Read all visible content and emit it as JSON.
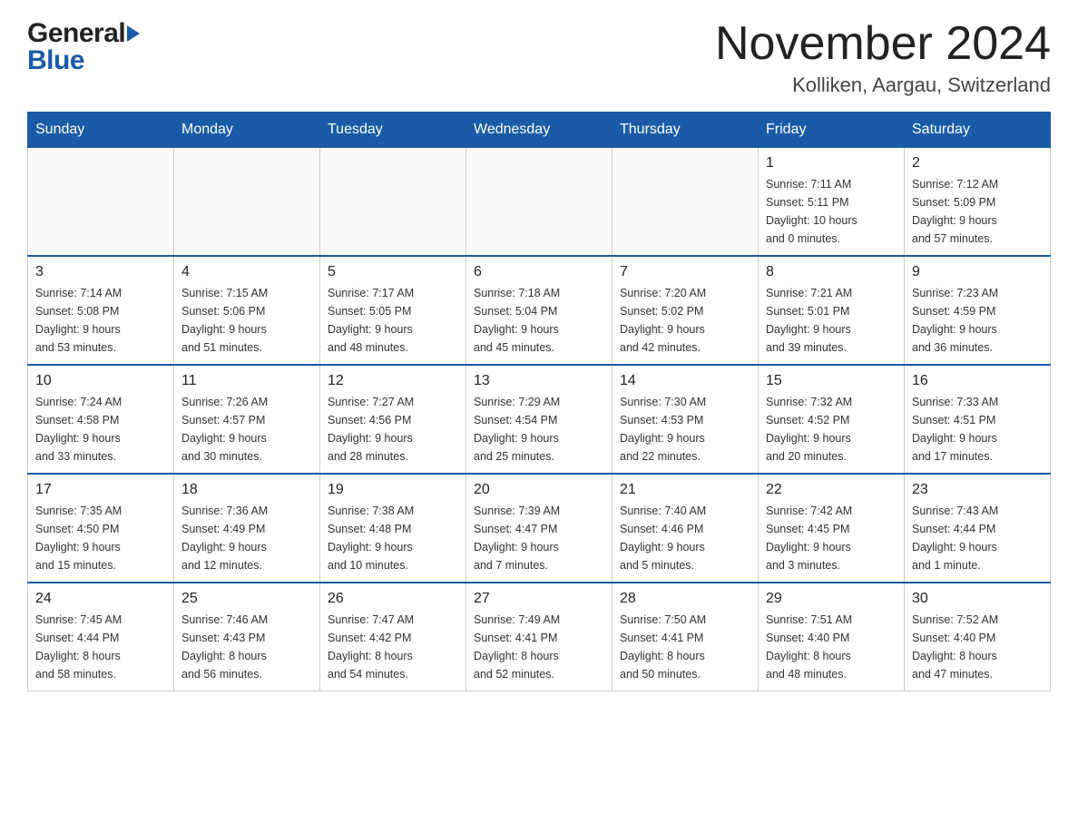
{
  "header": {
    "logo_general": "General",
    "logo_blue": "Blue",
    "title": "November 2024",
    "subtitle": "Kolliken, Aargau, Switzerland"
  },
  "days_of_week": [
    "Sunday",
    "Monday",
    "Tuesday",
    "Wednesday",
    "Thursday",
    "Friday",
    "Saturday"
  ],
  "weeks": [
    {
      "days": [
        {
          "date": "",
          "info": ""
        },
        {
          "date": "",
          "info": ""
        },
        {
          "date": "",
          "info": ""
        },
        {
          "date": "",
          "info": ""
        },
        {
          "date": "",
          "info": ""
        },
        {
          "date": "1",
          "info": "Sunrise: 7:11 AM\nSunset: 5:11 PM\nDaylight: 10 hours\nand 0 minutes."
        },
        {
          "date": "2",
          "info": "Sunrise: 7:12 AM\nSunset: 5:09 PM\nDaylight: 9 hours\nand 57 minutes."
        }
      ]
    },
    {
      "days": [
        {
          "date": "3",
          "info": "Sunrise: 7:14 AM\nSunset: 5:08 PM\nDaylight: 9 hours\nand 53 minutes."
        },
        {
          "date": "4",
          "info": "Sunrise: 7:15 AM\nSunset: 5:06 PM\nDaylight: 9 hours\nand 51 minutes."
        },
        {
          "date": "5",
          "info": "Sunrise: 7:17 AM\nSunset: 5:05 PM\nDaylight: 9 hours\nand 48 minutes."
        },
        {
          "date": "6",
          "info": "Sunrise: 7:18 AM\nSunset: 5:04 PM\nDaylight: 9 hours\nand 45 minutes."
        },
        {
          "date": "7",
          "info": "Sunrise: 7:20 AM\nSunset: 5:02 PM\nDaylight: 9 hours\nand 42 minutes."
        },
        {
          "date": "8",
          "info": "Sunrise: 7:21 AM\nSunset: 5:01 PM\nDaylight: 9 hours\nand 39 minutes."
        },
        {
          "date": "9",
          "info": "Sunrise: 7:23 AM\nSunset: 4:59 PM\nDaylight: 9 hours\nand 36 minutes."
        }
      ]
    },
    {
      "days": [
        {
          "date": "10",
          "info": "Sunrise: 7:24 AM\nSunset: 4:58 PM\nDaylight: 9 hours\nand 33 minutes."
        },
        {
          "date": "11",
          "info": "Sunrise: 7:26 AM\nSunset: 4:57 PM\nDaylight: 9 hours\nand 30 minutes."
        },
        {
          "date": "12",
          "info": "Sunrise: 7:27 AM\nSunset: 4:56 PM\nDaylight: 9 hours\nand 28 minutes."
        },
        {
          "date": "13",
          "info": "Sunrise: 7:29 AM\nSunset: 4:54 PM\nDaylight: 9 hours\nand 25 minutes."
        },
        {
          "date": "14",
          "info": "Sunrise: 7:30 AM\nSunset: 4:53 PM\nDaylight: 9 hours\nand 22 minutes."
        },
        {
          "date": "15",
          "info": "Sunrise: 7:32 AM\nSunset: 4:52 PM\nDaylight: 9 hours\nand 20 minutes."
        },
        {
          "date": "16",
          "info": "Sunrise: 7:33 AM\nSunset: 4:51 PM\nDaylight: 9 hours\nand 17 minutes."
        }
      ]
    },
    {
      "days": [
        {
          "date": "17",
          "info": "Sunrise: 7:35 AM\nSunset: 4:50 PM\nDaylight: 9 hours\nand 15 minutes."
        },
        {
          "date": "18",
          "info": "Sunrise: 7:36 AM\nSunset: 4:49 PM\nDaylight: 9 hours\nand 12 minutes."
        },
        {
          "date": "19",
          "info": "Sunrise: 7:38 AM\nSunset: 4:48 PM\nDaylight: 9 hours\nand 10 minutes."
        },
        {
          "date": "20",
          "info": "Sunrise: 7:39 AM\nSunset: 4:47 PM\nDaylight: 9 hours\nand 7 minutes."
        },
        {
          "date": "21",
          "info": "Sunrise: 7:40 AM\nSunset: 4:46 PM\nDaylight: 9 hours\nand 5 minutes."
        },
        {
          "date": "22",
          "info": "Sunrise: 7:42 AM\nSunset: 4:45 PM\nDaylight: 9 hours\nand 3 minutes."
        },
        {
          "date": "23",
          "info": "Sunrise: 7:43 AM\nSunset: 4:44 PM\nDaylight: 9 hours\nand 1 minute."
        }
      ]
    },
    {
      "days": [
        {
          "date": "24",
          "info": "Sunrise: 7:45 AM\nSunset: 4:44 PM\nDaylight: 8 hours\nand 58 minutes."
        },
        {
          "date": "25",
          "info": "Sunrise: 7:46 AM\nSunset: 4:43 PM\nDaylight: 8 hours\nand 56 minutes."
        },
        {
          "date": "26",
          "info": "Sunrise: 7:47 AM\nSunset: 4:42 PM\nDaylight: 8 hours\nand 54 minutes."
        },
        {
          "date": "27",
          "info": "Sunrise: 7:49 AM\nSunset: 4:41 PM\nDaylight: 8 hours\nand 52 minutes."
        },
        {
          "date": "28",
          "info": "Sunrise: 7:50 AM\nSunset: 4:41 PM\nDaylight: 8 hours\nand 50 minutes."
        },
        {
          "date": "29",
          "info": "Sunrise: 7:51 AM\nSunset: 4:40 PM\nDaylight: 8 hours\nand 48 minutes."
        },
        {
          "date": "30",
          "info": "Sunrise: 7:52 AM\nSunset: 4:40 PM\nDaylight: 8 hours\nand 47 minutes."
        }
      ]
    }
  ]
}
